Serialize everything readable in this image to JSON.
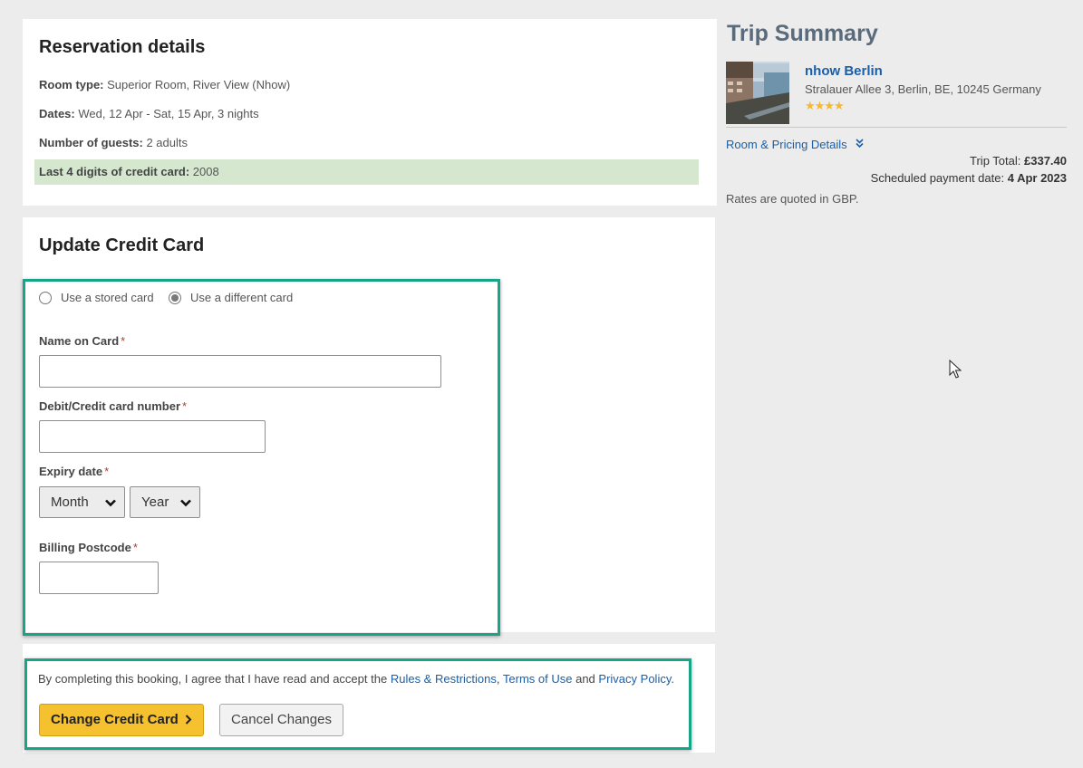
{
  "reservation": {
    "title": "Reservation details",
    "room_type_label": "Room type:",
    "room_type_value": "Superior Room, River View (Nhow)",
    "dates_label": "Dates:",
    "dates_value": "Wed, 12 Apr - Sat, 15 Apr, 3 nights",
    "guests_label": "Number of guests:",
    "guests_value": "2 adults",
    "card_digits_label": "Last 4 digits of credit card:",
    "card_digits_value": "2008"
  },
  "update_card": {
    "title": "Update Credit Card",
    "radio_stored_label": "Use a stored card",
    "radio_different_label": "Use a different card",
    "selected_option": "different",
    "name_label": "Name on Card",
    "name_value": "",
    "number_label": "Debit/Credit card number",
    "number_value": "",
    "expiry_label": "Expiry date",
    "month_selected": "Month",
    "year_selected": "Year",
    "postcode_label": "Billing Postcode",
    "postcode_value": "",
    "required_mark": "*"
  },
  "agreement": {
    "text_prefix": "By completing this booking, I agree that I have read and accept the",
    "rules_link": "Rules & Restrictions",
    "comma": ",",
    "terms_link": "Terms of Use",
    "and_word": "and",
    "privacy_link": "Privacy Policy",
    "period": ".",
    "change_button": "Change Credit Card",
    "change_button_icon": "chevron-right",
    "cancel_button": "Cancel Changes"
  },
  "trip_summary": {
    "title": "Trip Summary",
    "hotel_name": "nhow Berlin",
    "hotel_address": "Stralauer Allee 3, Berlin, BE, 10245 Germany",
    "star_rating": 4,
    "stars_text": "★★★★",
    "pricing_link": "Room & Pricing Details",
    "trip_total_label": "Trip Total:",
    "trip_total_value": "£337.40",
    "payment_date_label": "Scheduled payment date:",
    "payment_date_value": "4 Apr 2023",
    "rates_note": "Rates are quoted in GBP."
  },
  "colors": {
    "highlight_green": "#17a589",
    "primary_button": "#f5c12e",
    "link_blue": "#1a5fa8",
    "card_row_highlight": "#d5e8cf",
    "star_color": "#f5b82e"
  }
}
